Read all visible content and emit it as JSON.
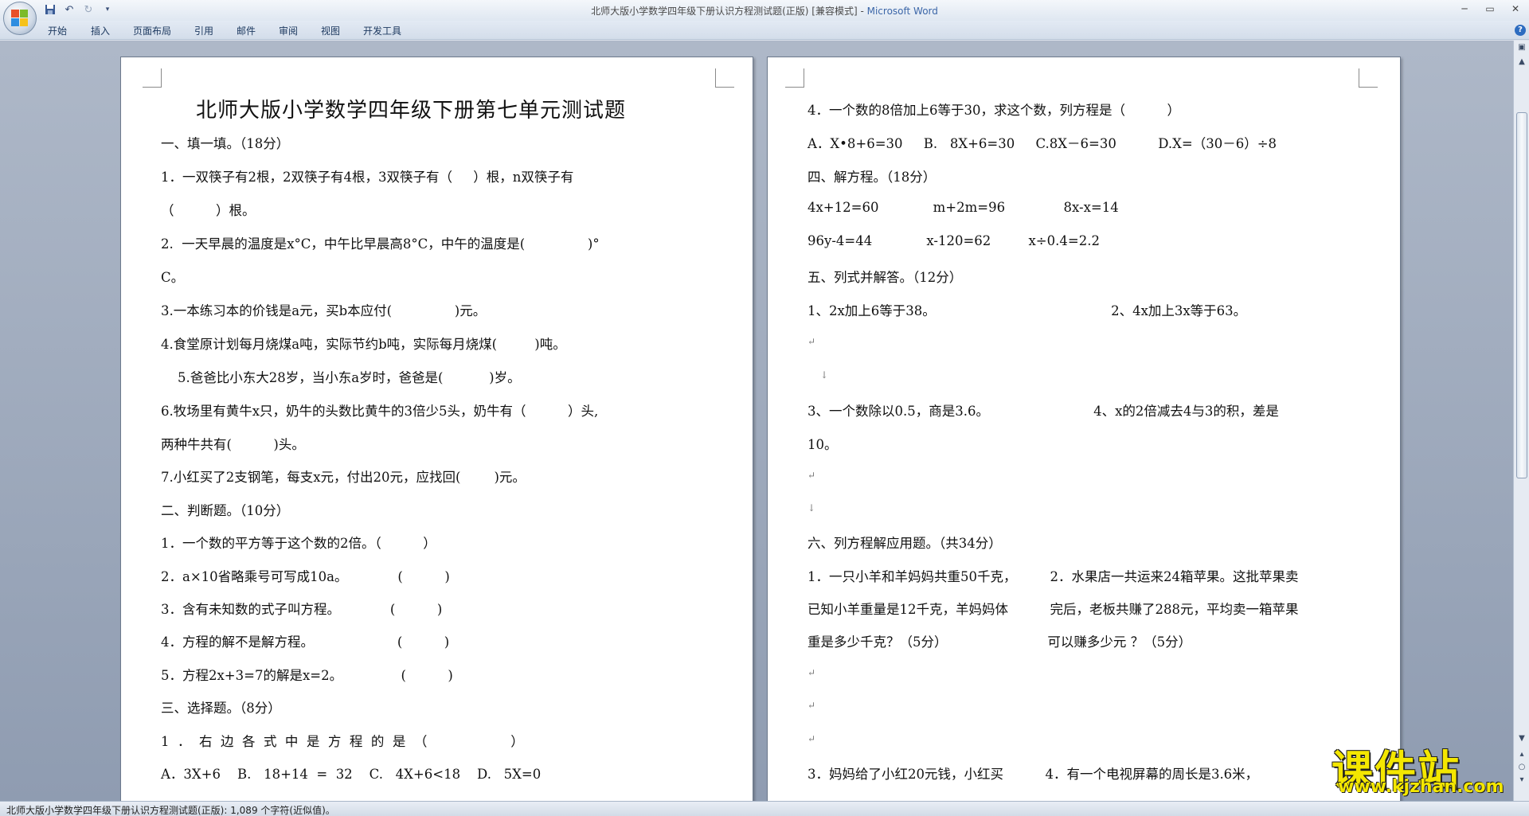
{
  "window": {
    "title": "北师大版小学数学四年级下册认识方程测试题(正版) [兼容模式] - ",
    "app_name": "Microsoft Word"
  },
  "quick_access": {
    "icons": [
      "save-icon",
      "undo-icon",
      "redo-icon",
      "customize-icon"
    ]
  },
  "ribbon": {
    "tabs": [
      "开始",
      "插入",
      "页面布局",
      "引用",
      "邮件",
      "审阅",
      "视图",
      "开发工具"
    ]
  },
  "left_page": {
    "title": "北师大版小学数学四年级下册第七单元测试题",
    "lines": [
      "一、填一填。（18分）",
      "1．一双筷子有2根，2双筷子有4根，3双筷子有（     ）根，n双筷子有",
      "（          ）根。",
      "2.  一天早晨的温度是x°C，中午比早晨高8°C，中午的温度是(               )°",
      "C。",
      "3.一本练习本的价钱是a元，买b本应付(               )元。",
      "4.食堂原计划每月烧煤a吨，实际节约b吨，实际每月烧煤(         )吨。",
      "    5.爸爸比小东大28岁，当小东a岁时，爸爸是(           )岁。",
      "6.牧场里有黄牛x只，奶牛的头数比黄牛的3倍少5头，奶牛有（          ）头,",
      "两种牛共有(          )头。",
      "7.小红买了2支钢笔，每支x元，付出20元，应找回(        )元。",
      "二、判断题。（10分）",
      "1．一个数的平方等于这个数的2倍。（          ）",
      "2．a×10省略乘号可写成10a。            (          )",
      "3．含有未知数的式子叫方程。            (          )",
      "4．方程的解不是解方程。                    (          )",
      "5．方程2x+3=7的解是x=2。              (          )",
      "三、选择题。（8分）",
      "1  ．  右  边  各  式  中  是  方  程  的  是  （                    ）",
      "A．3X+6    B.   18+14  =  32    C.   4X+6<18    D.   5X=0"
    ]
  },
  "right_page": {
    "lines": [
      "4．一个数的8倍加上6等于30，求这个数，列方程是（          ）",
      "A．X•8+6=30     B.   8X+6=30     C.8X－6=30          D.X=（30－6）÷8",
      "四、解方程。（18分）",
      "4x+12=60             m+2m=96              8x-x=14",
      "96y-4=44             x-120=62         x÷0.4=2.2",
      "五、列式并解答。（12分）",
      "1、2x加上6等于38。                                          2、4x加上3x等于63。",
      "",
      "",
      "3、一个数除以0.5，商是3.6。                         4、x的2倍减去4与3的积，差是",
      "10。",
      "",
      "",
      "六、列方程解应用题。（共34分）",
      "1．一只小羊和羊妈妈共重50千克，        2．水果店一共运来24箱苹果。这批苹果卖",
      "已知小羊重量是12千克，羊妈妈体          完后，老板共赚了288元，平均卖一箱苹果",
      "重是多少千克？（5分）                        可以赚多少元 ？（5分）",
      "",
      "",
      "",
      "3．妈妈给了小红20元钱，小红买          4．有一个电视屏幕的周长是3.6米，"
    ]
  },
  "status_bar": {
    "text": "北师大版小学数学四年级下册认识方程测试题(正版): 1,089 个字符(近似值)。"
  },
  "watermark": {
    "big": "课件站",
    "small": "www.kjzhan.com"
  }
}
